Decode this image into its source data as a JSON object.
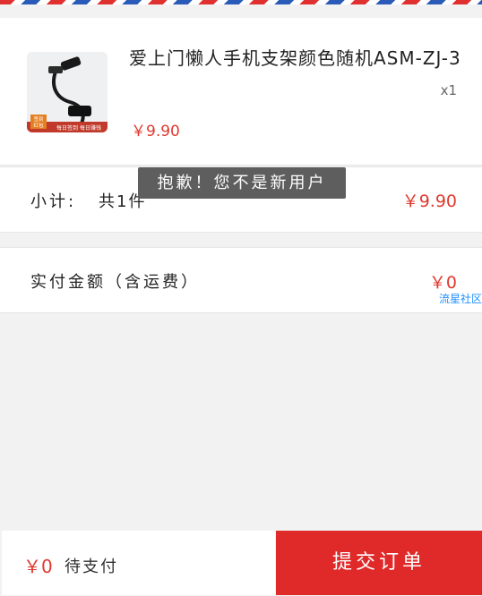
{
  "product": {
    "title": "爱上门懒人手机支架颜色随机ASM-ZJ-3",
    "quantity": "x1",
    "price": "￥9.90",
    "thumbnail": {
      "badge_line1": "签到",
      "badge_line2": "红包",
      "caption": "每日签到  每日赚钱"
    }
  },
  "subtotal": {
    "label": "小计:",
    "count_text": "共1件",
    "amount": "￥9.90"
  },
  "toast": {
    "message": "抱歉！您不是新用户"
  },
  "payable": {
    "label": "实付金额（含运费）",
    "amount": "￥0",
    "watermark": "流星社区"
  },
  "footer": {
    "amount": "￥0",
    "status": "待支付",
    "submit_label": "提交订单"
  },
  "colors": {
    "accent_red": "#e02a2a",
    "price_red": "#e03a2f",
    "toast_bg": "#5e5e5e",
    "watermark_blue": "#1e90ff"
  }
}
